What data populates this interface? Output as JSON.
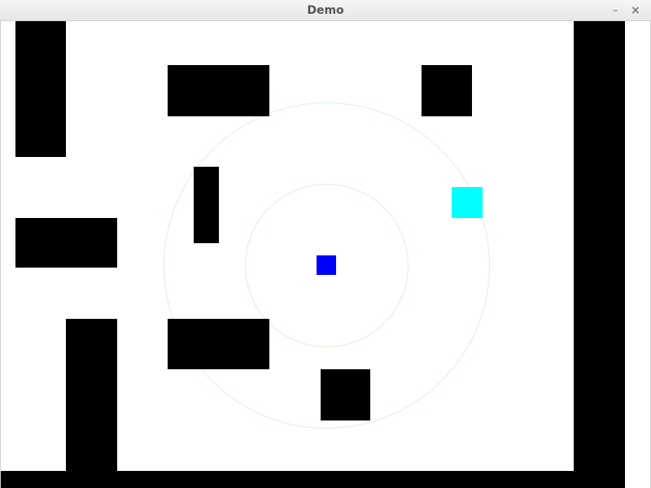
{
  "window": {
    "title": "Demo",
    "minimize_label": "–",
    "close_label": "×"
  },
  "colors": {
    "background": "#ffffff",
    "walls": "#000000",
    "player": "#0000ff",
    "target": "#00ffff",
    "range_rings": "#d9f1d9"
  },
  "scene": {
    "walls_count": 12,
    "entities": [
      "player",
      "target"
    ]
  }
}
